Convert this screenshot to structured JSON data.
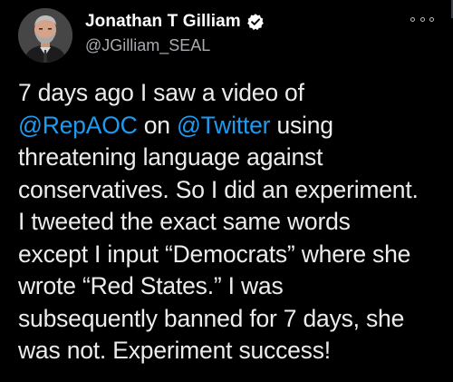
{
  "author": {
    "display_name": "Jonathan T Gilliam",
    "handle": "@JGilliam_SEAL",
    "verified": true,
    "avatar_icon": "profile-photo-icon",
    "verified_icon": "verified-badge-icon"
  },
  "more_icon": "more-options-icon",
  "colors": {
    "background": "#000000",
    "text": "#ececec",
    "muted": "#a7abaf",
    "link": "#1d9bf0",
    "verified_badge": "#ffffff"
  },
  "tweet": {
    "lines": {
      "l1": "7 days ago I saw a video of",
      "l2_mention1": "@RepAOC",
      "l2_mid": " on ",
      "l2_mention2": "@Twitter",
      "l2_end": " using",
      "l3": "threatening language against",
      "l4": "conservatives. So I did an experiment.",
      "l5": "I tweeted the exact same words",
      "l6": "except I input “Democrats” where she",
      "l7": "wrote “Red States.” I was",
      "l8": "subsequently banned for 7 days, she",
      "l9": "was not. Experiment success!"
    }
  }
}
